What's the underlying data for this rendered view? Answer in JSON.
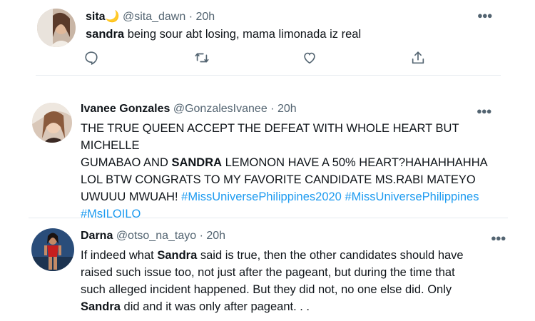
{
  "tweets": [
    {
      "display_name": "sita",
      "name_emoji": "🌙",
      "handle": "@sita_dawn",
      "separator": "·",
      "time": "20h",
      "text": {
        "bold": "sandra",
        "rest": " being sour abt losing, mama limonada iz real"
      }
    },
    {
      "display_name": "Ivanee Gonzales",
      "handle": "@GonzalesIvanee",
      "separator": "·",
      "time": "20h",
      "text": {
        "line1": "THE TRUE QUEEN ACCEPT THE DEFEAT WITH WHOLE HEART BUT MICHELLE",
        "line2_pre": "GUMABAO AND ",
        "line2_bold": "SANDRA",
        "line2_post": " LEMONON HAVE A 50% HEART?HAHAHHAHHA",
        "line3": "LOL BTW CONGRATS TO MY FAVORITE CANDIDATE MS.RABI MATEYO",
        "line4_pre": "UWUUU MWUAH! ",
        "tag1": "#MissUniversePhilippines2020",
        "tag2": "#MissUniversePhilippines",
        "tag3": "#MsILOILO"
      }
    },
    {
      "display_name": "Darna",
      "handle": "@otso_na_tayo",
      "separator": "·",
      "time": "20h",
      "text": {
        "line1_pre": "If indeed what ",
        "line1_bold": "Sandra",
        "line1_post": " said is true, then the other candidates should have",
        "line2": "raised such issue too, not just after the pageant, but during the time that",
        "line3": "such alleged incident happened. But they did not, no one else did. Only",
        "line4_bold": "Sandra",
        "line4_post": " did and it was only after pageant. . ."
      }
    }
  ],
  "icons": {
    "more": "more-horizontal-icon",
    "reply": "reply-icon",
    "retweet": "retweet-icon",
    "like": "heart-icon",
    "share": "share-icon"
  },
  "colors": {
    "text": "#0f1419",
    "meta": "#536471",
    "hashtag": "#1d9bf0",
    "divider": "#e6ecf0"
  }
}
